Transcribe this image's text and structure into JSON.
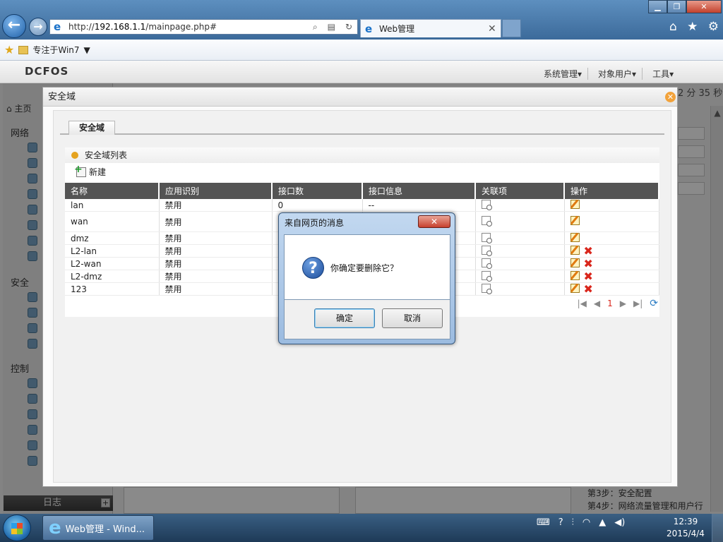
{
  "browser": {
    "address_url_prefix": "http://",
    "address_url_host": "192.168.1.1",
    "address_url_path": "/mainpage.php#",
    "tab_title": "Web管理",
    "favorites_item": "专注于Win7"
  },
  "page": {
    "logo": "DCFOS",
    "top_menu": [
      "系统管理▾",
      "对象用户▾",
      "工具▾"
    ],
    "clock_fragment": "2 分 35 秒",
    "sidebar": {
      "home": "主页",
      "cat_network": "网络",
      "cat_security": "安全",
      "cat_control": "控制",
      "cat_log": "日志"
    },
    "steps": [
      "第3步：安全配置",
      "第4步：网络流量管理和用户行"
    ]
  },
  "modal": {
    "title": "安全域",
    "tab_label": "安全域",
    "list_title": "安全域列表",
    "new_label": "新建",
    "columns": [
      "名称",
      "应用识别",
      "接口数",
      "接口信息",
      "关联项",
      "操作"
    ],
    "rows": [
      {
        "name": "lan",
        "app": "禁用",
        "count": "0",
        "info": "--",
        "deletable": false
      },
      {
        "name": "wan",
        "app": "禁用",
        "count": "",
        "info": "",
        "deletable": false
      },
      {
        "name": "dmz",
        "app": "禁用",
        "count": "",
        "info": "",
        "deletable": false
      },
      {
        "name": "L2-lan",
        "app": "禁用",
        "count": "",
        "info": "",
        "deletable": true
      },
      {
        "name": "L2-wan",
        "app": "禁用",
        "count": "",
        "info": "",
        "deletable": true
      },
      {
        "name": "L2-dmz",
        "app": "禁用",
        "count": "",
        "info": "",
        "deletable": true
      },
      {
        "name": "123",
        "app": "禁用",
        "count": "",
        "info": "",
        "deletable": true
      }
    ],
    "page_number": "1"
  },
  "dialog": {
    "title": "来自网页的消息",
    "message": "你确定要删除它？",
    "ok_label": "确定",
    "cancel_label": "取消",
    "close_glyph": "✕"
  },
  "taskbar": {
    "item_label": "Web管理 - Wind...",
    "time": "12:39",
    "date": "2015/4/4"
  }
}
